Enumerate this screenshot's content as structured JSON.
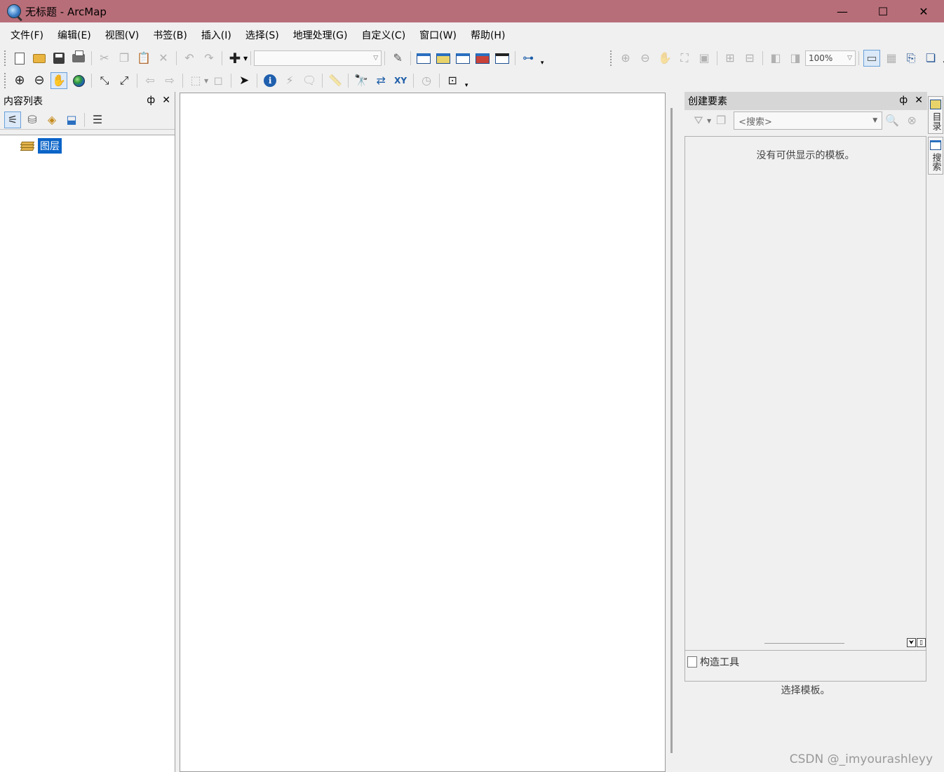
{
  "window": {
    "title": "无标题 - ArcMap",
    "controls": {
      "minimize": "—",
      "maximize": "☐",
      "close": "✕"
    }
  },
  "menu": [
    "文件(F)",
    "编辑(E)",
    "视图(V)",
    "书签(B)",
    "插入(I)",
    "选择(S)",
    "地理处理(G)",
    "自定义(C)",
    "窗口(W)",
    "帮助(H)"
  ],
  "standard_toolbar": {
    "scale_value": "",
    "zoom_value": "100%"
  },
  "toc": {
    "title": "内容列表",
    "pin": "ф",
    "close": "✕",
    "root_label": "图层"
  },
  "create_features": {
    "title": "创建要素",
    "pin": "ф",
    "close": "✕",
    "search_placeholder": "<搜索>",
    "empty_message": "没有可供显示的模板。",
    "construction_title": "构造工具",
    "construction_message": "选择模板。"
  },
  "side_tabs": [
    "目录",
    "搜索"
  ],
  "watermark": "CSDN @_imyourashleyy"
}
